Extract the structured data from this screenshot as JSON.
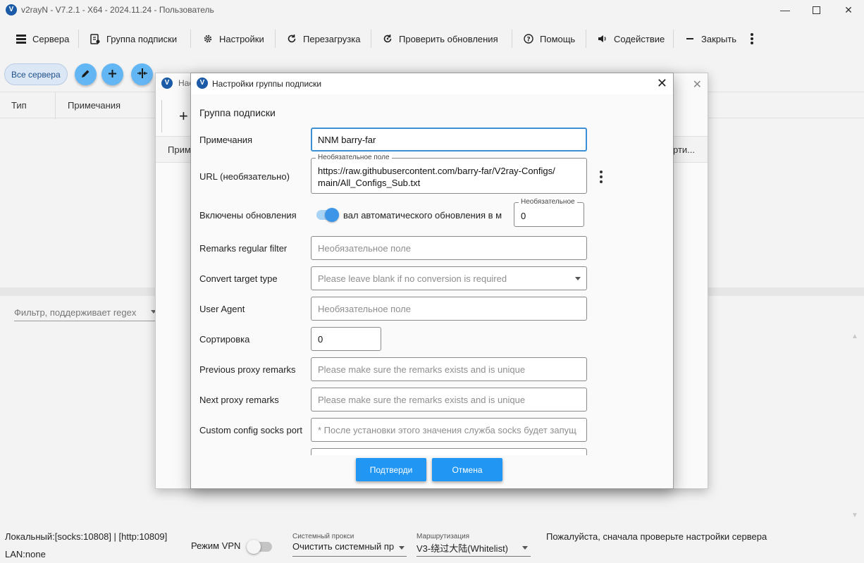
{
  "window": {
    "title": "v2rayN - V7.2.1 - X64 - 2024.11.24 - Пользователь",
    "logo_letter": "V"
  },
  "menu": {
    "servers": "Сервера",
    "subscription_group": "Группа подписки",
    "settings": "Настройки",
    "reload": "Перезагрузка",
    "check_updates": "Проверить обновления",
    "help": "Помощь",
    "promotion": "Содействие",
    "close": "Закрыть"
  },
  "toolbar": {
    "all_servers": "Все сервера"
  },
  "grid": {
    "columns": [
      "Тип",
      "Примечания"
    ]
  },
  "filter": {
    "placeholder": "Фильтр, поддерживает regex"
  },
  "background_dialog": {
    "title_fragment": "Нас",
    "column_left": "Прим",
    "column_right": "рти..."
  },
  "dialog": {
    "title": "Настройки группы подписки",
    "section": "Группа подписки",
    "remarks_label": "Примечания",
    "remarks_value": "NNM barry-far",
    "url_label": "URL (необязательно)",
    "url_float_label": "Необязательное поле",
    "url_value_line1": "https://raw.githubusercontent.com/barry-far/V2ray-Configs/",
    "url_value_line2": "main/All_Configs_Sub.txt",
    "updates_label": "Включены обновления",
    "auto_update_text": "вал автоматического обновления в м",
    "interval_float_label": "Необязательное",
    "interval_value": "0",
    "regex_label": "Remarks regular filter",
    "regex_placeholder": "Необязательное поле",
    "convert_label": "Convert target type",
    "convert_placeholder": "Please leave blank if no conversion is required",
    "user_agent_label": "User Agent",
    "user_agent_placeholder": "Необязательное поле",
    "sort_label": "Сортировка",
    "sort_value": "0",
    "prev_proxy_label": "Previous proxy remarks",
    "prev_proxy_placeholder": "Please make sure the remarks exists and is unique",
    "next_proxy_label": "Next proxy remarks",
    "next_proxy_placeholder": "Please make sure the remarks exists and is unique",
    "socks_port_label": "Custom config socks port",
    "socks_port_placeholder": "* После установки этого значения служба socks будет запущ",
    "confirm_button": "Подтверди",
    "cancel_button": "Отмена"
  },
  "status": {
    "local": "Локальный:[socks:10808] | [http:10809]",
    "lan": "LAN:none",
    "vpn_mode": "Режим VPN",
    "system_proxy_label": "Системный прокси",
    "system_proxy_value": "Очистить системный пр",
    "routing_label": "Маршрутизация",
    "routing_value": "V3-绕过大陆(Whitelist)",
    "message": "Пожалуйста, сначала проверьте настройки сервера"
  },
  "colors": {
    "accent": "#2196f3",
    "fab": "#63b6f4",
    "focus_border": "#3d8fd6",
    "toggle_on": "#3d95e8"
  }
}
